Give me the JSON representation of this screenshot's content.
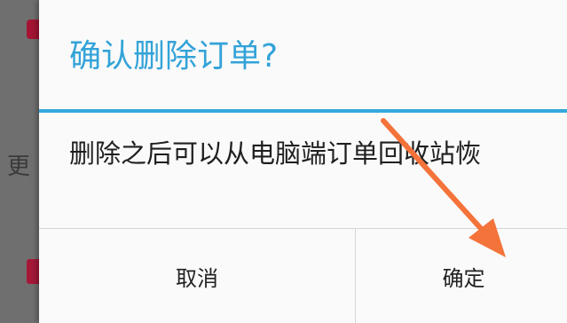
{
  "dialog": {
    "title": "确认删除订单?",
    "message": "删除之后可以从电脑端订单回收站恢",
    "cancel_label": "取消",
    "confirm_label": "确定"
  },
  "background": {
    "partial_text": "更"
  },
  "colors": {
    "title": "#33a3d8",
    "divider": "#33a8dc",
    "annotation_arrow": "#f4733a",
    "badge": "#a31532"
  }
}
